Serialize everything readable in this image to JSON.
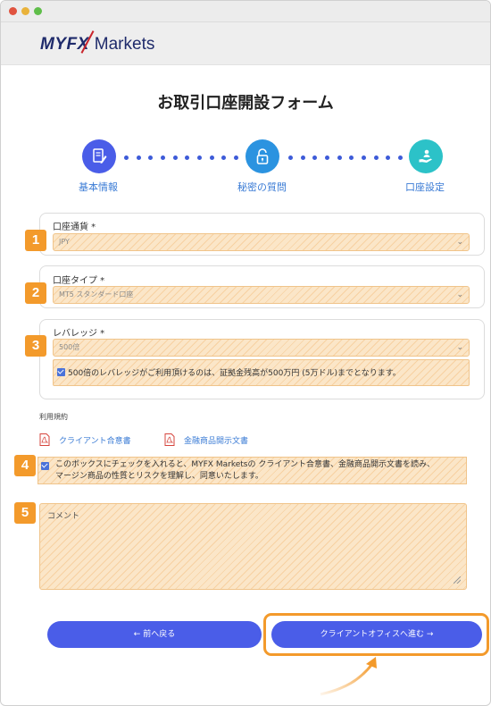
{
  "brand": {
    "logo_text_1": "MYFX",
    "logo_text_2": "Markets"
  },
  "page_title": "お取引口座開設フォーム",
  "steps": [
    {
      "label": "基本情報",
      "icon": "document-edit-icon",
      "color": "#4a5de8"
    },
    {
      "label": "秘密の質問",
      "icon": "unlock-icon",
      "color": "#2b93e0"
    },
    {
      "label": "口座設定",
      "icon": "hand-user-icon",
      "color": "#2cc2c8"
    }
  ],
  "fields": {
    "currency": {
      "label": "口座通貨 *",
      "value": "JPY"
    },
    "account_type": {
      "label": "口座タイプ *",
      "value": "MT5 スタンダード口座"
    },
    "leverage": {
      "label": "レバレッジ *",
      "value": "500倍",
      "note": "500倍のレバレッジがご利用頂けるのは、証拠金残高が500万円 (5万ドル)までとなります。"
    }
  },
  "terms": {
    "title": "利用規約",
    "docs": [
      "クライアント合意書",
      "金融商品開示文書"
    ],
    "agree_line1": "このボックスにチェックを入れると、MYFX Marketsの クライアント合意書、金融商品開示文書を読み、",
    "agree_line2": "マージン商品の性質とリスクを理解し、同意いたします。"
  },
  "comment": {
    "placeholder": "コメント"
  },
  "badges": [
    "1",
    "2",
    "3",
    "4",
    "5"
  ],
  "buttons": {
    "back": "← 前へ戻る",
    "next": "クライアントオフィスへ進む →"
  },
  "colors": {
    "accent": "#4a5de8",
    "highlight": "#f39a2b",
    "hatch": "#fbe6c8"
  }
}
